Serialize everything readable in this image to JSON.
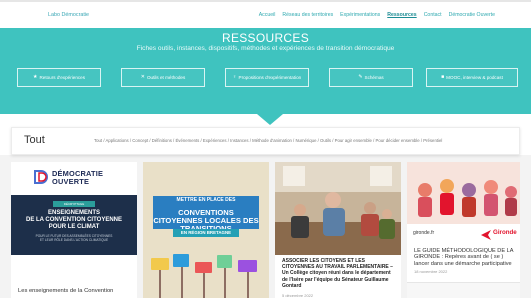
{
  "topbar": {
    "brand": "Labo Démocratie",
    "nav": [
      {
        "label": "Accueil",
        "active": false
      },
      {
        "label": "Réseau des territoires",
        "active": false
      },
      {
        "label": "Expérimentations",
        "active": false
      },
      {
        "label": "Ressources",
        "active": true
      },
      {
        "label": "Contact",
        "active": false
      },
      {
        "label": "Démocratie Ouverte",
        "active": false
      }
    ]
  },
  "hero": {
    "title": "RESSOURCES",
    "subtitle": "Fiches outils, instances, dispositifs, méthodes et expériences de transition démocratique",
    "buttons": [
      {
        "icon": "★",
        "label": "Retours d'expériences"
      },
      {
        "icon": "✕",
        "label": "Outils et méthodes"
      },
      {
        "icon": "♀",
        "label": "Propositions d'expérimentation"
      },
      {
        "icon": "✎",
        "label": "Schémas"
      },
      {
        "icon": "■",
        "label": "MOOC, interview & podcast"
      }
    ]
  },
  "filters": {
    "current": "Tout",
    "items": "Tout / Applications / Concept / Définitions / Événements / Expériences / Instances / Méthode d'animation / Numérique / Outils / Pour agir ensemble / Pour décider ensemble / Présentiel"
  },
  "cards": {
    "c1": {
      "logo_line1": "DÉMOCRATIE",
      "logo_line2": "OUVERTE",
      "pill": "DÉCRYPTAGE",
      "heading": "ENSEIGNEMENTS\nDE LA CONVENTION CITOYENNE\nPOUR LE CLIMAT",
      "small": "POUR LE FUTUR DES ASSEMBLÉES CITOYENNES\nET LEUR RÔLE DANS L'ACTION CLIMATIQUE",
      "title": "Les enseignements de la Convention"
    },
    "c2": {
      "band1": "METTRE EN PLACE DES",
      "band2": "CONVENTIONS CITOYENNES LOCALES DES TRANSITIONS",
      "band3": "EN RÉGION BRETAGNE"
    },
    "c3": {
      "body": "ASSOCIER LES CITOYENS ET LES CITOYENNES AU TRAVAIL PARLEMENTAIRE – Un Collège citoyen réuni dans le département de l'Isère par l'équipe du Sénateur Guillaume Gontard",
      "date": "5 décembre 2022"
    },
    "c4": {
      "logo_left": "gironde.fr",
      "logo_right": "Gironde",
      "body": "LE GUIDE MÉTHODOLOGIQUE DE LA GIRONDE : Repères avant de ( se ) lancer dans une démarche participative",
      "date": "18 novembre 2022"
    }
  },
  "colors": {
    "hero": "#3fc3bf",
    "nav": "#2fa9b0",
    "dark_card": "#1d2f4a",
    "accent_red": "#e2142d"
  }
}
